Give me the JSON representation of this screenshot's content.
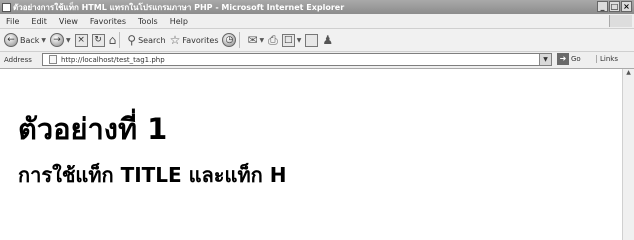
{
  "window": {
    "title": "ตัวอย่างการใช้แท็ก HTML แทรกในโปรแกรมภาษา PHP - Microsoft Internet Explorer",
    "controls": [
      "_",
      "□",
      "×"
    ]
  },
  "menu": {
    "items": [
      "File",
      "Edit",
      "View",
      "Favorites",
      "Tools",
      "Help"
    ]
  },
  "toolbar": {
    "back_label": "Back",
    "search_label": "Search",
    "favorites_label": "Favorites"
  },
  "address": {
    "label": "Address",
    "url": "http://localhost/test_tag1.php",
    "go_label": "Go",
    "links_label": "Links"
  },
  "page": {
    "heading1": "ตัวอย่างที่ 1",
    "heading2": "การใช้แท็ก TITLE และแท็ก H"
  }
}
